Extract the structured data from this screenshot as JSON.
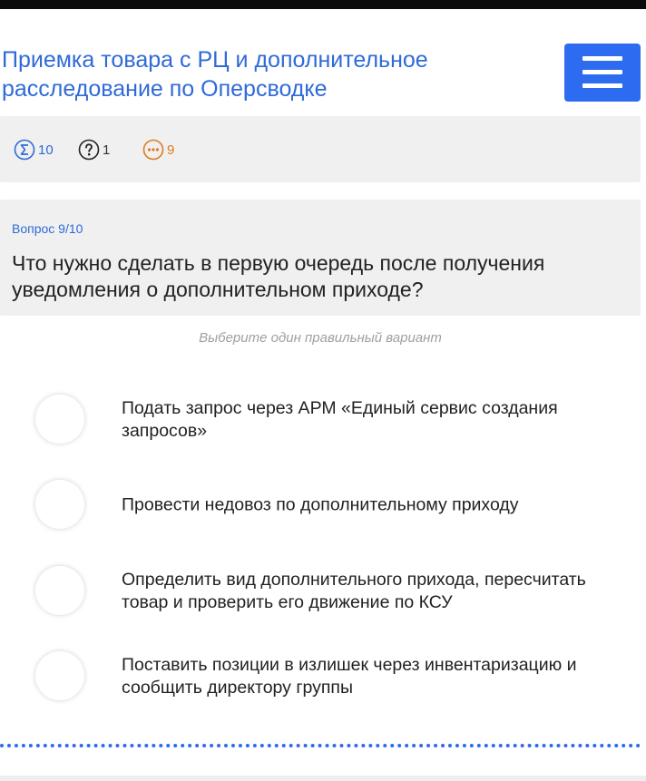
{
  "header": {
    "course_title": "Приемка товара с РЦ и дополнительное расследование по Оперсводке",
    "menu_icon": "hamburger-menu-icon"
  },
  "stats": {
    "total": {
      "icon": "sigma-icon",
      "value": "10"
    },
    "unanswered": {
      "icon": "question-mark-icon",
      "value": "1"
    },
    "remaining": {
      "icon": "ellipsis-icon",
      "value": "9"
    }
  },
  "question": {
    "number_label": "Вопрос 9/10",
    "text": "Что нужно сделать в первую очередь после получения уведомления о дополнительном приходе?",
    "instruction": "Выберите один правильный вариант"
  },
  "options": [
    {
      "label": "Подать запрос через АРМ «Единый сервис создания запросов»",
      "selected": false
    },
    {
      "label": "Провести недовоз по дополнительному приходу",
      "selected": false
    },
    {
      "label": "Определить вид дополнительного прихода, пересчитать товар и проверить его движение по КСУ",
      "selected": false
    },
    {
      "label": "Поставить позиции в излишек через инвентаризацию и сообщить директору группы",
      "selected": false
    }
  ],
  "colors": {
    "accent": "#2d6bf1",
    "title": "#2f6ad8",
    "remaining": "#e07a1f",
    "panel": "#f0f0f0"
  }
}
